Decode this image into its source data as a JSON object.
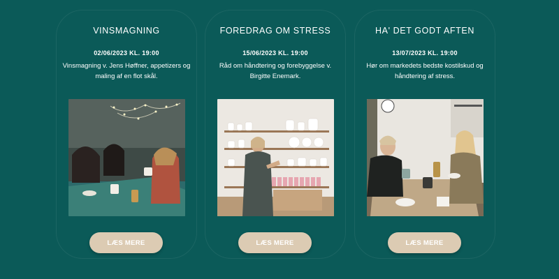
{
  "events": [
    {
      "title": "VINSMAGNING",
      "date": "02/06/2023 KL. 19:00",
      "description": "Vinsmagning v. Jens Høffner, appetizers og maling af en flot skål.",
      "photo": "people-painting-ceramics-at-table-photo",
      "button": "LÆS MERE"
    },
    {
      "title": "FOREDRAG OM STRESS",
      "date": "15/06/2023 KL. 19:00",
      "description": "Råd om håndtering og forebyggelse v. Birgitte Enemark.",
      "photo": "woman-speaking-in-ceramics-shop-photo",
      "button": "LÆS MERE"
    },
    {
      "title": "HA' DET GODT AFTEN",
      "date": "13/07/2023 KL. 19:00",
      "description": "Hør om markedets bedste kostilskud og håndtering af stress.",
      "photo": "two-women-at-cafe-table-photo",
      "button": "LÆS MERE"
    }
  ],
  "colors": {
    "background": "#0b5a58",
    "button": "#dccbb3",
    "text": "#ffffff"
  }
}
